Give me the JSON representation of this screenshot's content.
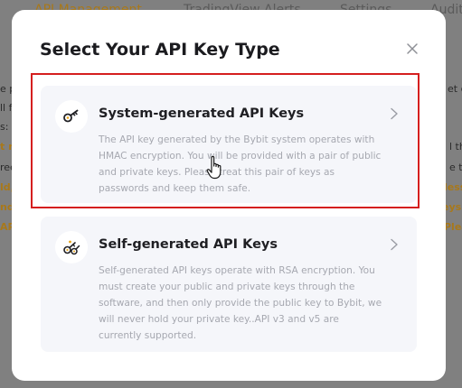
{
  "background": {
    "tabs": [
      "API Management",
      "TradingView Alerts",
      "Settings",
      "Audit"
    ],
    "fragments": [
      "e po",
      "ll fo",
      "s:",
      "t re",
      "reea",
      "ld, l",
      "nde",
      "API",
      "et d",
      "l th",
      "e th",
      "less",
      "eys.",
      "Plea"
    ]
  },
  "modal": {
    "title": "Select Your API Key Type",
    "options": [
      {
        "title": "System-generated API Keys",
        "description": [
          "The API key generated by the Bybit system operates with",
          "HMAC encryption. You will be provided with a pair of public",
          "and private keys. Please treat this pair of keys as",
          "passwords and keep them safe."
        ],
        "icon": "key-icon",
        "highlighted": true
      },
      {
        "title": "Self-generated API Keys",
        "description": [
          "Self-generated API keys operate with RSA encryption. You",
          "must create your public and private keys through the",
          "software, and then only provide the public key to Bybit, we",
          "will never hold your private key..API v3 and v5 are",
          "currently supported."
        ],
        "icon": "keys-icon"
      }
    ]
  },
  "colors": {
    "highlight_border": "#d51f1f",
    "accent": "#a8781a",
    "card_bg": "#f5f6fa"
  }
}
